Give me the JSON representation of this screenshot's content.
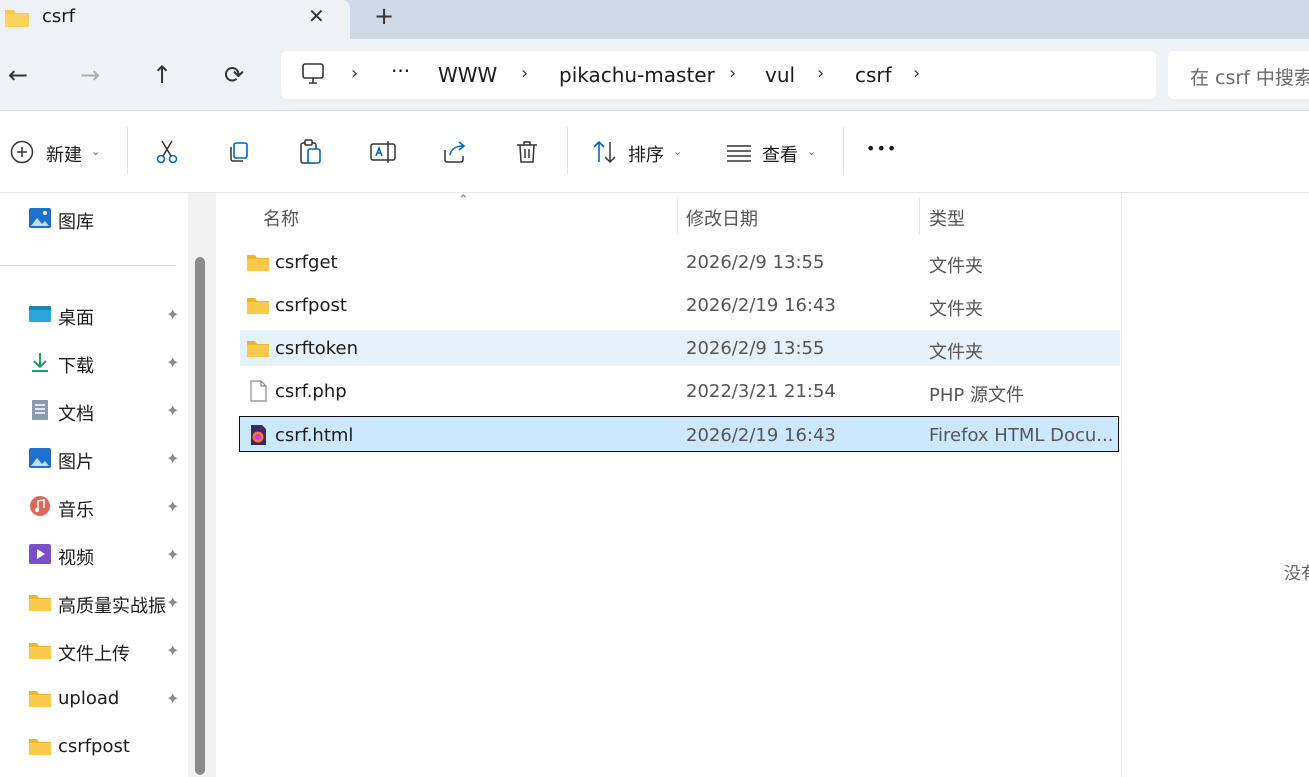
{
  "tab": {
    "title": "csrf",
    "close": "✕",
    "new": "+"
  },
  "nav": {
    "back": "←",
    "forward": "→",
    "up": "↑",
    "refresh": "⟳",
    "breadcrumbs": [
      "WWW",
      "pikachu-master",
      "vul",
      "csrf"
    ],
    "overflow": "···",
    "sep": "›",
    "search_placeholder": "在 csrf 中搜索"
  },
  "toolbar": {
    "new_label": "新建",
    "sort_label": "排序",
    "view_label": "查看",
    "more": "•••"
  },
  "sidebar": {
    "items": [
      {
        "label": "图库",
        "icon": "gallery-icon",
        "pinned": false
      },
      {
        "label": "桌面",
        "icon": "desktop-icon",
        "pinned": true
      },
      {
        "label": "下载",
        "icon": "download-icon",
        "pinned": true
      },
      {
        "label": "文档",
        "icon": "document-icon",
        "pinned": true
      },
      {
        "label": "图片",
        "icon": "pictures-icon",
        "pinned": true
      },
      {
        "label": "音乐",
        "icon": "music-icon",
        "pinned": true
      },
      {
        "label": "视频",
        "icon": "video-icon",
        "pinned": true
      },
      {
        "label": "高质量实战振",
        "icon": "folder-icon",
        "pinned": true
      },
      {
        "label": "文件上传",
        "icon": "folder-icon",
        "pinned": true
      },
      {
        "label": "upload",
        "icon": "folder-icon",
        "pinned": true
      },
      {
        "label": "csrfpost",
        "icon": "folder-icon",
        "pinned": false
      }
    ],
    "pin_glyph": "📌"
  },
  "columns": {
    "name": "名称",
    "date": "修改日期",
    "type": "类型"
  },
  "files": [
    {
      "name": "csrfget",
      "date": "2026/2/9 13:55",
      "type": "文件夹",
      "icon": "folder-icon",
      "state": ""
    },
    {
      "name": "csrfpost",
      "date": "2026/2/19 16:43",
      "type": "文件夹",
      "icon": "folder-icon",
      "state": ""
    },
    {
      "name": "csrftoken",
      "date": "2026/2/9 13:55",
      "type": "文件夹",
      "icon": "folder-icon",
      "state": "hover"
    },
    {
      "name": "csrf.php",
      "date": "2022/3/21 21:54",
      "type": "PHP 源文件",
      "icon": "file-icon",
      "state": ""
    },
    {
      "name": "csrf.html",
      "date": "2026/2/19 16:43",
      "type": "Firefox HTML Docu...",
      "icon": "firefox-html-icon",
      "state": "selected"
    }
  ],
  "preview": {
    "text": "没有"
  },
  "colors": {
    "accent": "#0067c0",
    "selected": "#cce8ff",
    "hover": "#e5f1fb",
    "folder": "#f8c94a"
  }
}
